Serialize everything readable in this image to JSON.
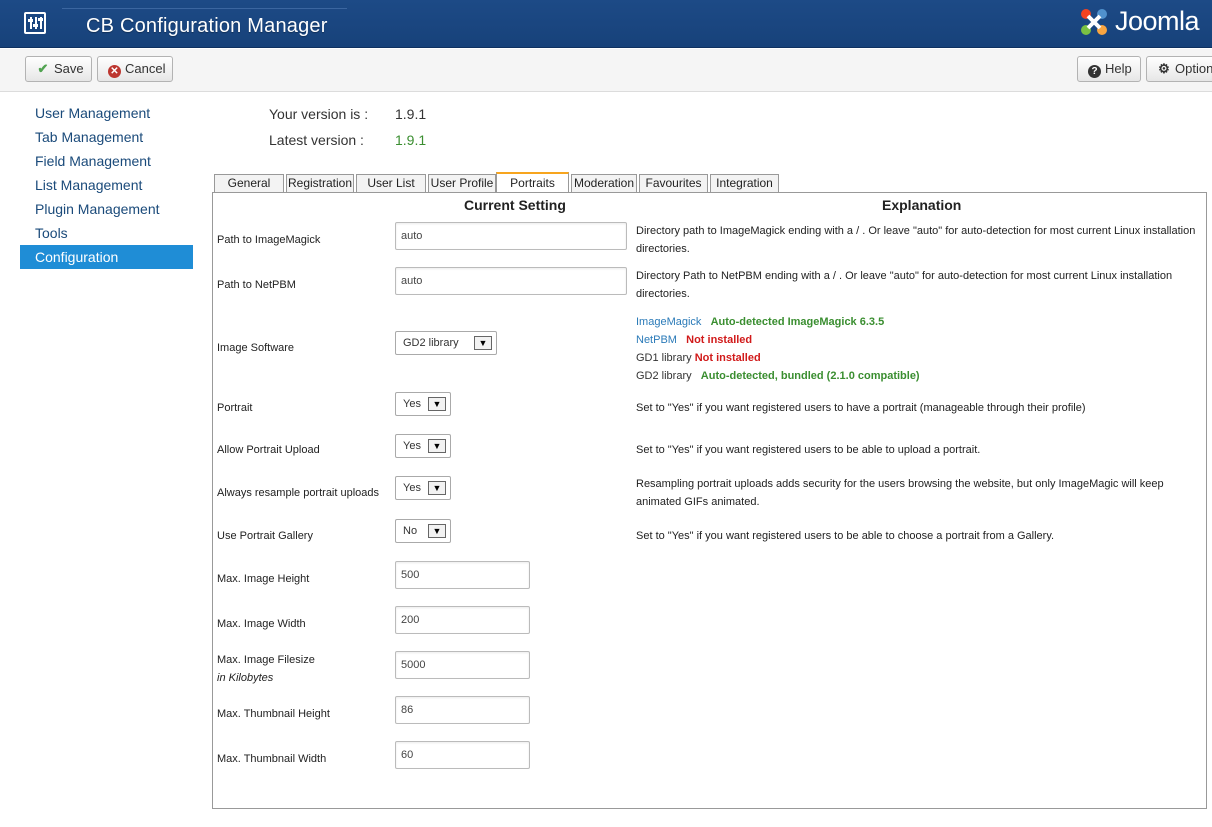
{
  "header": {
    "title": "CB Configuration Manager",
    "brand": "Joomla"
  },
  "toolbar": {
    "save": "Save",
    "cancel": "Cancel",
    "help": "Help",
    "options": "Options"
  },
  "sidebar": {
    "items": [
      {
        "label": "User Management"
      },
      {
        "label": "Tab Management"
      },
      {
        "label": "Field Management"
      },
      {
        "label": "List Management"
      },
      {
        "label": "Plugin Management"
      },
      {
        "label": "Tools"
      },
      {
        "label": "Configuration",
        "active": true
      }
    ]
  },
  "version": {
    "yours_label": "Your version is :",
    "yours_value": "1.9.1",
    "latest_label": "Latest version :",
    "latest_value": "1.9.1"
  },
  "tabs": [
    "General",
    "Registration",
    "User List",
    "User Profile",
    "Portraits",
    "Moderation",
    "Favourites",
    "Integration"
  ],
  "active_tab": "Portraits",
  "columns": {
    "setting": "Current Setting",
    "explanation": "Explanation"
  },
  "fields": {
    "imagemagick": {
      "label": "Path to ImageMagick",
      "value": "auto",
      "explanation": "Directory path to ImageMagick ending with a / . Or leave \"auto\" for auto-detection for most current Linux installation directories."
    },
    "netpbm": {
      "label": "Path to NetPBM",
      "value": "auto",
      "explanation": "Directory Path to NetPBM ending with a / . Or leave \"auto\" for auto-detection for most current Linux installation directories."
    },
    "software": {
      "label": "Image Software",
      "value": "GD2 library"
    },
    "portrait": {
      "label": "Portrait",
      "value": "Yes",
      "explanation": "Set to \"Yes\" if you want registered users to have a portrait (manageable through their profile)"
    },
    "upload": {
      "label": "Allow Portrait Upload",
      "value": "Yes",
      "explanation": "Set to \"Yes\" if you want registered users to be able to upload a portrait."
    },
    "resample": {
      "label": "Always resample portrait uploads",
      "value": "Yes",
      "explanation": "Resampling portrait uploads adds security for the users browsing the website, but only ImageMagic will keep animated GIFs animated."
    },
    "gallery": {
      "label": "Use Portrait Gallery",
      "value": "No",
      "explanation": "Set to \"Yes\" if you want registered users to be able to choose a portrait from a Gallery."
    },
    "max_height": {
      "label": "Max. Image Height",
      "value": "500"
    },
    "max_width": {
      "label": "Max. Image Width",
      "value": "200"
    },
    "max_filesize": {
      "label": "Max. Image Filesize",
      "sublabel": "in Kilobytes",
      "value": "5000"
    },
    "thumb_height": {
      "label": "Max. Thumbnail Height",
      "value": "86"
    },
    "thumb_width": {
      "label": "Max. Thumbnail Width",
      "value": "60"
    }
  },
  "software_status": [
    {
      "name": "ImageMagick",
      "status": "Auto-detected ImageMagick 6.3.5"
    },
    {
      "name": "NetPBM",
      "status": "Not installed"
    },
    {
      "name": "GD1 library",
      "status": "Not installed"
    },
    {
      "name": "GD2 library",
      "status": "Auto-detected, bundled (2.1.0 compatible)"
    }
  ],
  "colors": {
    "header": "#1d4a86",
    "active_nav": "#1f8dd6",
    "ok": "#3a8e30",
    "error": "#d11a1a",
    "tab_accent": "#f7a51e"
  }
}
